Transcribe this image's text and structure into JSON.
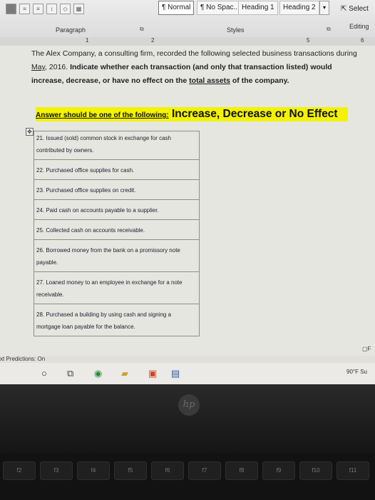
{
  "ribbon": {
    "styles": [
      "¶ Normal",
      "¶ No Spac...",
      "Heading 1",
      "Heading 2"
    ],
    "select_label": "Select",
    "paragraph_label": "Paragraph",
    "styles_label": "Styles",
    "editing_label": "Editing"
  },
  "ruler": {
    "marks": [
      "1",
      "2",
      "5",
      "6"
    ]
  },
  "document": {
    "intro_a": "The Alex Company, a consulting firm, recorded the following selected business transactions during ",
    "intro_month": "May",
    "intro_b": ", 2016. ",
    "intro_c": "Indicate whether each transaction (and only that transaction listed) would increase, decrease, or have no effect on the ",
    "intro_total": "total assets",
    "intro_d": " of the company.",
    "answer_prefix": "Answer should be one of the following:",
    "answer_options": " Increase, Decrease or No Effect",
    "transactions": [
      "21. Issued (sold) common stock in exchange for cash contributed by owners.",
      "22. Purchased office supplies for cash.",
      "23. Purchased office supplies on credit.",
      "24. Paid cash on accounts payable to a supplier.",
      "25. Collected cash on accounts receivable.",
      "26. Borrowed money from the bank on a promissory note payable.",
      "27. Loaned money to an employee in exchange for a note receivable.",
      "28. Purchased a building by using cash and signing a mortgage loan payable for the balance."
    ]
  },
  "status": {
    "predictions": "xt Predictions: On",
    "weather": "90°F  Su"
  },
  "taskbar_icons": [
    "search-icon",
    "task-view-icon",
    "chrome-icon",
    "file-explorer-icon",
    "office-icon",
    "word-icon"
  ],
  "keyboard": {
    "keys": [
      "f2",
      "f3",
      "f4",
      "f5",
      "f6",
      "f7",
      "f8",
      "f9",
      "f10",
      "f11"
    ]
  }
}
